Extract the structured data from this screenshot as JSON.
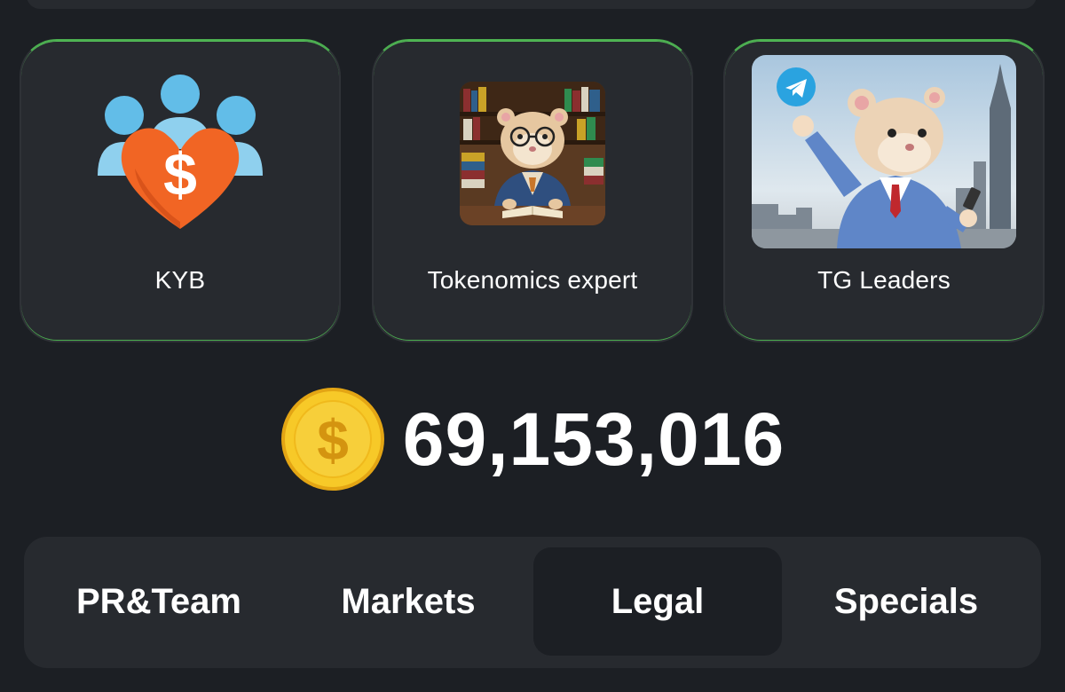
{
  "cards": [
    {
      "label": "KYB",
      "icon": "kyb-people-heart-dollar-icon"
    },
    {
      "label": "Tokenomics expert",
      "icon": "hamster-scholar-image"
    },
    {
      "label": "TG Leaders",
      "icon": "hamster-telegram-leader-image"
    }
  ],
  "balance": {
    "value": "69,153,016",
    "icon": "gold-coin-icon"
  },
  "tabs": [
    {
      "label": "PR&Team",
      "selected": false
    },
    {
      "label": "Markets",
      "selected": false
    },
    {
      "label": "Legal",
      "selected": true
    },
    {
      "label": "Specials",
      "selected": false
    }
  ],
  "colors": {
    "background": "#1c1f24",
    "card": "#272a2f",
    "accent_green": "#55c15a",
    "coin_gold": "#f5c518",
    "text": "#ffffff"
  }
}
